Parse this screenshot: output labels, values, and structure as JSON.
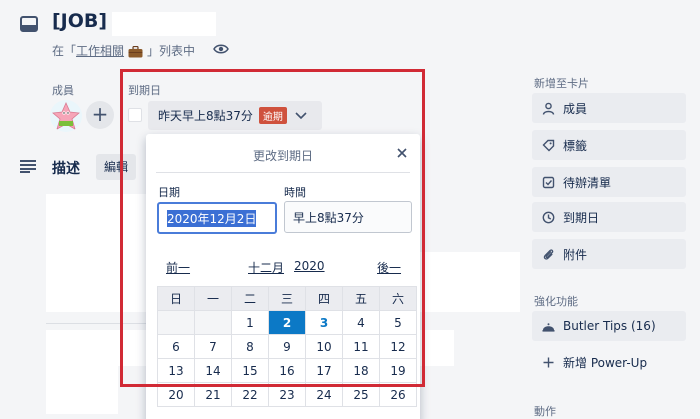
{
  "header": {
    "card_title": "[JOB]",
    "in_list_prefix": "在「",
    "list_name": "工作相關",
    "in_list_suffix": "」列表中"
  },
  "members": {
    "label": "成員",
    "add": "+"
  },
  "due": {
    "label": "到期日",
    "value": "昨天早上8點37分",
    "badge": "逾期"
  },
  "description": {
    "title": "描述",
    "edit_label": "編輯"
  },
  "popover": {
    "title": "更改到期日",
    "date_label": "日期",
    "time_label": "時間",
    "date_value": "2020年12月2日",
    "time_value": "早上8點37分",
    "prev": "前一",
    "month": "十二月",
    "year": "2020",
    "next": "後一",
    "weekdays": [
      "日",
      "一",
      "二",
      "三",
      "四",
      "五",
      "六"
    ],
    "weeks": [
      [
        "",
        "",
        "1",
        "2",
        "3",
        "4",
        "5"
      ],
      [
        "6",
        "7",
        "8",
        "9",
        "10",
        "11",
        "12"
      ],
      [
        "13",
        "14",
        "15",
        "16",
        "17",
        "18",
        "19"
      ],
      [
        "20",
        "21",
        "22",
        "23",
        "24",
        "25",
        "26"
      ]
    ],
    "selected_day": "2",
    "today_day": "3"
  },
  "sidebar": {
    "add_to_card": "新增至卡片",
    "items": [
      "成員",
      "標籤",
      "待辦清單",
      "到期日",
      "附件"
    ],
    "powerups_title": "強化功能",
    "butler": "Butler Tips (16)",
    "add_powerup": "新增 Power-Up",
    "actions_title": "動作"
  },
  "colors": {
    "highlight": "#d12a35",
    "overdue": "#cf513d",
    "selected": "#0c79c6"
  }
}
